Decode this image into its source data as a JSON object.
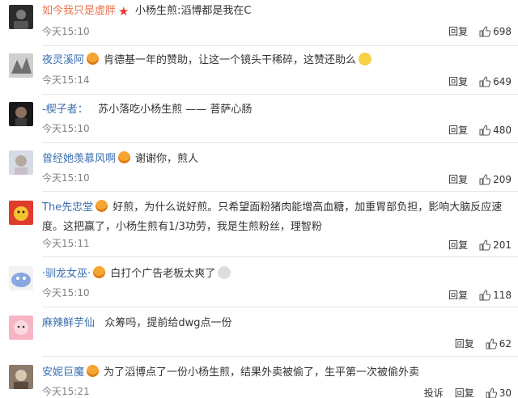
{
  "comments": [
    {
      "user": "如今我只是虚胖",
      "text": "小杨生煎:滔博都是我在C",
      "time": "今天15:10",
      "reply": "回复",
      "likes": "698"
    },
    {
      "user": "夜灵溪阿",
      "text": "肯德基一年的赞助，让这一个镜头干稀碎，这赞还助么",
      "time": "今天15:14",
      "reply": "回复",
      "likes": "649"
    },
    {
      "user": "-楔子者：",
      "text": "苏小落吃小杨生煎 —— 菩萨心肠",
      "time": "今天15:10",
      "reply": "回复",
      "likes": "480"
    },
    {
      "user": "曾经她羡慕风啊",
      "text": "谢谢你，煎人",
      "time": "今天15:10",
      "reply": "回复",
      "likes": "209"
    },
    {
      "user": "The先忠堂",
      "text": "好煎，为什么说好煎。只希望面粉猪肉能增高血糖，加重胃部负担，影响大脑反应速度。这把赢了，小杨生煎有1/3功劳，我是生煎粉丝，理智粉",
      "time": "今天15:11",
      "reply": "回复",
      "likes": "201"
    },
    {
      "user": "·驯龙女巫·",
      "text": "白打个广告老板太爽了",
      "time": "今天15:10",
      "reply": "回复",
      "likes": "118"
    },
    {
      "user": "麻辣鲜芋仙",
      "text": "众筹吗，提前给dwg点一份",
      "time": "",
      "reply": "回复",
      "likes": "62"
    },
    {
      "user": "安妮巨魔",
      "text": "为了滔博点了一份小杨生煎，结果外卖被偷了，生平第一次被偷外卖",
      "time": "今天15:21",
      "report": "投诉",
      "reply": "回复",
      "likes": "30"
    }
  ]
}
